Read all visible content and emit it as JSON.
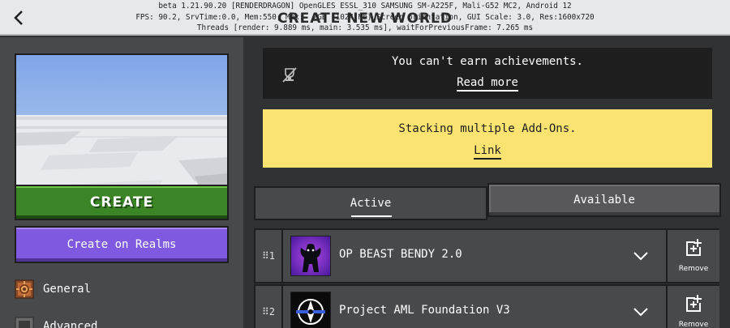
{
  "header": {
    "title": "CREATE NEW WORLD",
    "debug_lines": [
      "beta 1.21.90.20 [RENDERDRAGON] OpenGLES ESSL_310 SAMSUNG SM-A225F, Mali-G52 MC2, Android 12",
      "FPS: 90.2, SrvTime:0.0, Mem:550, Max:  2GB (1024 Mb) Screen orientation, GUI Scale: 3.0, Res:1600x720",
      "Threads [render: 9.889 ms, main: 3.535 ms], waitForPreviousFrame: 7.265 ms"
    ]
  },
  "sidebar": {
    "create_label": "CREATE",
    "realms_label": "Create on Realms",
    "items": [
      {
        "label": "General",
        "icon": "gear-block-icon"
      },
      {
        "label": "Advanced",
        "icon": "advanced-icon"
      }
    ]
  },
  "notices": {
    "achievements": {
      "message": "You can't earn achievements.",
      "link": "Read more"
    },
    "addons": {
      "message": "Stacking multiple Add-Ons.",
      "link": "Link"
    }
  },
  "tabs": {
    "active": "Active",
    "available": "Available"
  },
  "packs": [
    {
      "index": "1",
      "name": "OP BEAST BENDY 2.0",
      "remove_label": "Remove"
    },
    {
      "index": "2",
      "name": "Project AML Foundation V3",
      "remove_label": "Remove"
    }
  ],
  "colors": {
    "create_green": "#3c8527",
    "realms_purple": "#7f5ae0",
    "notice_yellow": "#fbe372",
    "panel_dark": "#48494a"
  }
}
